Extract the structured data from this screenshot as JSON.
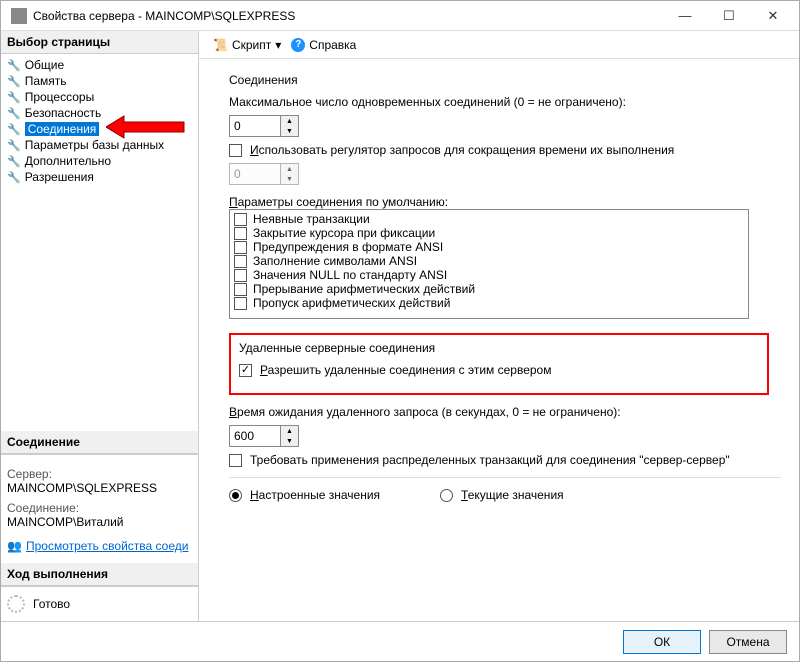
{
  "window": {
    "title": "Свойства сервера - MAINCOMP\\SQLEXPRESS"
  },
  "sidebar": {
    "header": "Выбор страницы",
    "items": [
      {
        "label": "Общие"
      },
      {
        "label": "Память"
      },
      {
        "label": "Процессоры"
      },
      {
        "label": "Безопасность"
      },
      {
        "label": "Соединения",
        "selected": true
      },
      {
        "label": "Параметры базы данных"
      },
      {
        "label": "Дополнительно"
      },
      {
        "label": "Разрешения"
      }
    ]
  },
  "connection_panel": {
    "header": "Соединение",
    "server_label": "Сервер:",
    "server_value": "MAINCOMP\\SQLEXPRESS",
    "conn_label": "Соединение:",
    "conn_value": "MAINCOMP\\Виталий",
    "view_link": "Просмотреть свойства соеди"
  },
  "progress_panel": {
    "header": "Ход выполнения",
    "status": "Готово"
  },
  "toolbar": {
    "script": "Скрипт",
    "help": "Справка"
  },
  "form": {
    "connections": {
      "title": "Соединения",
      "max_conn_label": "Максимальное число одновременных соединений (0 = не ограничено):",
      "max_conn_value": "0",
      "use_governor": "Использовать регулятор запросов для сокращения времени их выполнения",
      "governor_value": "0",
      "defaults_title": "Параметры соединения по умолчанию:",
      "options": [
        "Неявные транзакции",
        "Закрытие курсора при фиксации",
        "Предупреждения в формате ANSI",
        "Заполнение символами ANSI",
        "Значения NULL по стандарту ANSI",
        "Прерывание арифметических действий",
        "Пропуск арифметических действий"
      ]
    },
    "remote": {
      "title": "Удаленные серверные соединения",
      "allow_remote": "Разрешить удаленные соединения с этим сервером",
      "timeout_label": "Время ожидания удаленного запроса (в секундах, 0 = не ограничено):",
      "timeout_value": "600",
      "require_dist": "Требовать применения распределенных транзакций для соединения \"сервер-сервер\""
    },
    "radios": {
      "configured": "Настроенные значения",
      "current": "Текущие значения"
    }
  },
  "buttons": {
    "ok": "ОК",
    "cancel": "Отмена"
  }
}
